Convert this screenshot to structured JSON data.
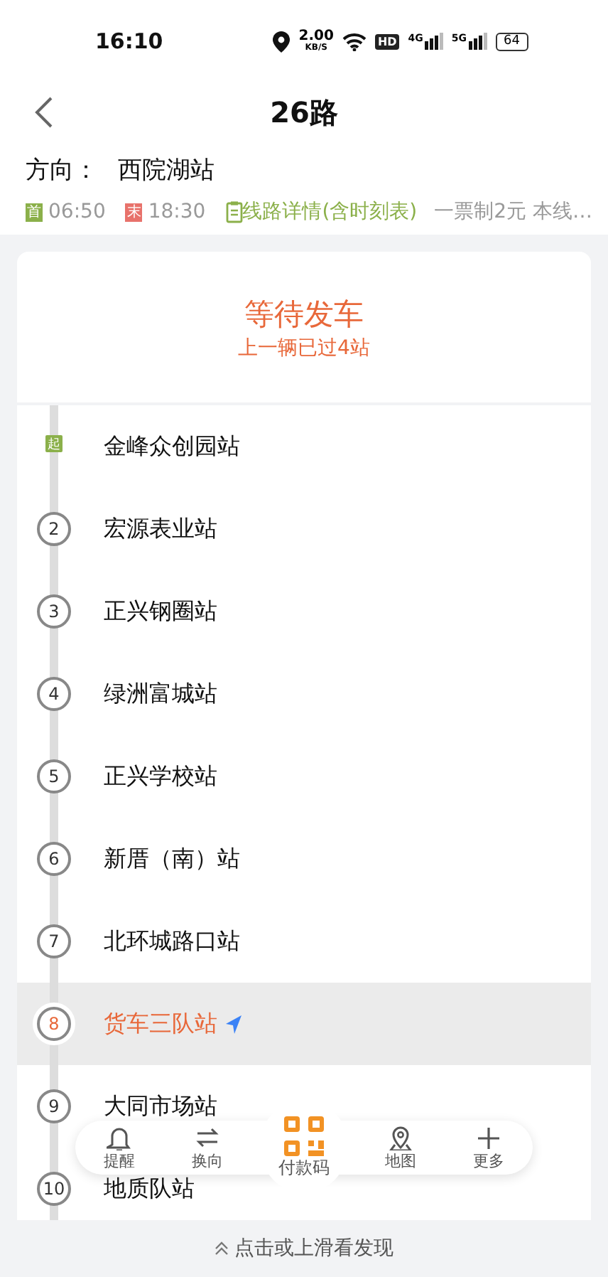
{
  "status_bar": {
    "time": "16:10",
    "speed": "2.00",
    "speed_unit": "KB/S",
    "hd": "HD",
    "net_1": "4G",
    "net_2": "5G",
    "battery": "64"
  },
  "header": {
    "title": "26路"
  },
  "route": {
    "direction_label": "方向：",
    "direction": "西院湖站",
    "first_badge": "首",
    "first_time": "06:50",
    "last_badge": "末",
    "last_time": "18:30",
    "details_link": "线路详情(含时刻表)",
    "fare": "一票制2元 本线…"
  },
  "status": {
    "title": "等待发车",
    "subtitle": "上一辆已过4站"
  },
  "stops": [
    {
      "kind": "start",
      "marker": "起",
      "name": "金峰众创园站",
      "selected": false
    },
    {
      "kind": "number",
      "marker": "2",
      "name": "宏源表业站",
      "selected": false
    },
    {
      "kind": "number",
      "marker": "3",
      "name": "正兴钢圈站",
      "selected": false
    },
    {
      "kind": "number",
      "marker": "4",
      "name": "绿洲富城站",
      "selected": false
    },
    {
      "kind": "number",
      "marker": "5",
      "name": "正兴学校站",
      "selected": false
    },
    {
      "kind": "number",
      "marker": "6",
      "name": "新厝（南）站",
      "selected": false
    },
    {
      "kind": "number",
      "marker": "7",
      "name": "北环城路口站",
      "selected": false
    },
    {
      "kind": "number",
      "marker": "8",
      "name": "货车三队站",
      "selected": true
    },
    {
      "kind": "number",
      "marker": "9",
      "name": "大同市场站",
      "selected": false
    },
    {
      "kind": "number",
      "marker": "10",
      "name": "地质队站",
      "selected": false
    }
  ],
  "bottom_nav": [
    {
      "kind": "normal",
      "label": "提醒"
    },
    {
      "kind": "normal",
      "label": "换向"
    },
    {
      "kind": "featured",
      "label": "付款码"
    },
    {
      "kind": "normal",
      "label": "地图"
    },
    {
      "kind": "normal",
      "label": "更多"
    }
  ],
  "footer": {
    "hint": "点击或上滑看发现"
  }
}
